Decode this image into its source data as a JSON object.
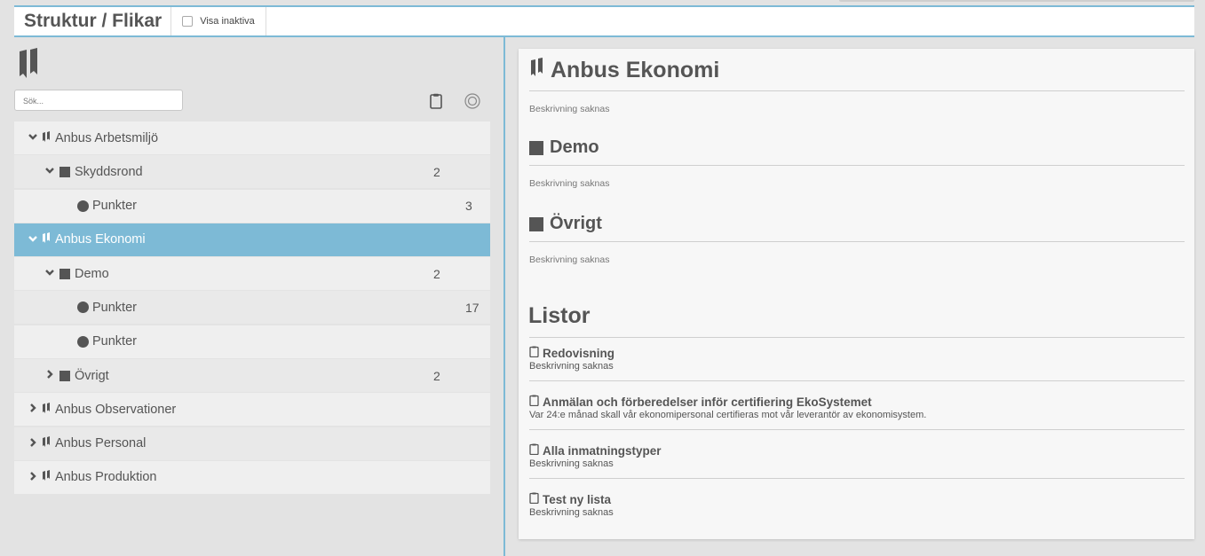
{
  "header": {
    "title": "Struktur / Flikar",
    "show_inactive_label": "Visa inaktiva"
  },
  "search": {
    "placeholder": "Sök..."
  },
  "tree": [
    {
      "label": "Anbus Arbetsmiljö",
      "level": 0,
      "type": "book",
      "caret": "down",
      "count": "",
      "selected": false
    },
    {
      "label": "Skyddsrond",
      "level": 1,
      "type": "square",
      "caret": "down",
      "count": "2",
      "selected": false
    },
    {
      "label": "Punkter",
      "level": 2,
      "type": "dot",
      "caret": "",
      "count": "3",
      "selected": false
    },
    {
      "label": "Anbus Ekonomi",
      "level": 0,
      "type": "book",
      "caret": "down",
      "count": "",
      "selected": true
    },
    {
      "label": "Demo",
      "level": 1,
      "type": "square",
      "caret": "down",
      "count": "2",
      "selected": false
    },
    {
      "label": "Punkter",
      "level": 2,
      "type": "dot",
      "caret": "",
      "count": "17",
      "selected": false
    },
    {
      "label": "Punkter",
      "level": 2,
      "type": "dot",
      "caret": "",
      "count": "",
      "selected": false
    },
    {
      "label": "Övrigt",
      "level": 1,
      "type": "square",
      "caret": "right",
      "count": "2",
      "selected": false
    },
    {
      "label": "Anbus Observationer",
      "level": 0,
      "type": "book",
      "caret": "right",
      "count": "",
      "selected": false
    },
    {
      "label": "Anbus Personal",
      "level": 0,
      "type": "book",
      "caret": "right",
      "count": "",
      "selected": false
    },
    {
      "label": "Anbus Produktion",
      "level": 0,
      "type": "book",
      "caret": "right",
      "count": "",
      "selected": false
    }
  ],
  "detail": {
    "title": "Anbus Ekonomi",
    "title_desc": "Beskrivning saknas",
    "sections": [
      {
        "title": "Demo",
        "desc": "Beskrivning saknas"
      },
      {
        "title": "Övrigt",
        "desc": "Beskrivning saknas"
      }
    ],
    "lists_heading": "Listor",
    "lists": [
      {
        "title": "Redovisning",
        "desc": "Beskrivning saknas"
      },
      {
        "title": "Anmälan och förberedelser inför certifiering EkoSystemet",
        "desc": "Var 24:e månad skall vår ekonomipersonal certifieras mot vår leverantör av ekonomisystem."
      },
      {
        "title": "Alla inmatningstyper",
        "desc": "Beskrivning saknas"
      },
      {
        "title": "Test ny lista",
        "desc": "Beskrivning saknas"
      }
    ]
  },
  "colors": {
    "accent": "#7dbad6",
    "text": "#555555",
    "background": "#e3e3e3"
  },
  "icons": {
    "section": "bookmark-icon",
    "tab": "square-icon",
    "point": "dot-icon",
    "list": "clipboard-icon",
    "reset": "target-icon"
  }
}
